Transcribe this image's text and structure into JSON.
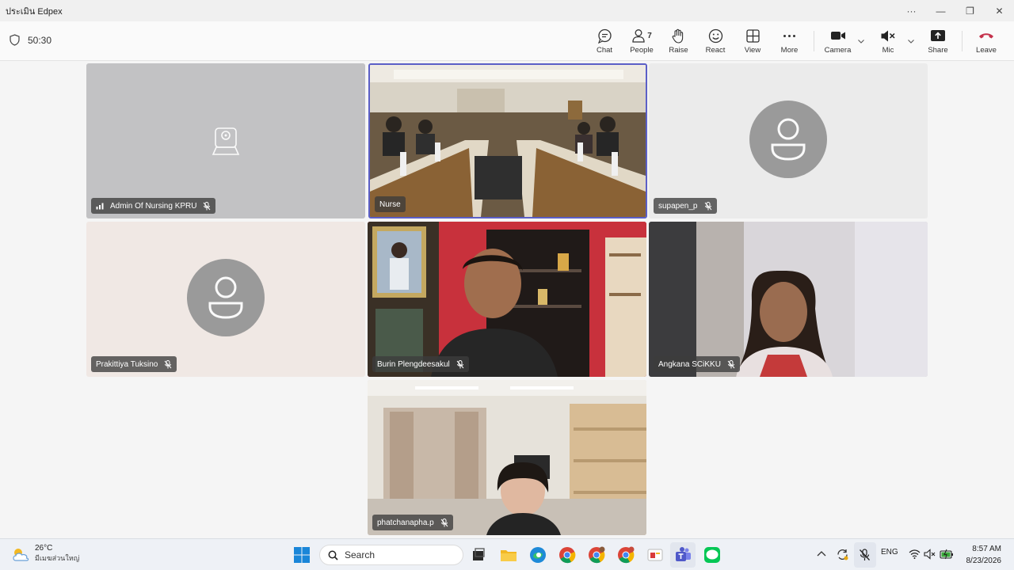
{
  "window": {
    "title": "ประเมิน Edpex"
  },
  "window_controls": {
    "more": "···",
    "minimize": "—",
    "maximize": "❐",
    "close": "✕"
  },
  "meeting": {
    "timer": "50:30"
  },
  "toolbar": {
    "chat": "Chat",
    "people": "People",
    "people_count": "7",
    "raise": "Raise",
    "react": "React",
    "view": "View",
    "more": "More",
    "camera": "Camera",
    "mic": "Mic",
    "share": "Share",
    "leave": "Leave"
  },
  "participants": [
    {
      "name": "Admin Of Nursing KPRU"
    },
    {
      "name": "Nurse"
    },
    {
      "name": "supapen_p"
    },
    {
      "name": "Prakittiya Tuksino"
    },
    {
      "name": "Burin Plengdeesakul"
    },
    {
      "name": "Angkana SCiKKU"
    },
    {
      "name": "phatchanapha.p"
    }
  ],
  "taskbar": {
    "weather_temp": "26°C",
    "weather_desc": "มีเมฆส่วนใหญ่",
    "search_label": "Search",
    "lang": "ENG",
    "time": "8:57 AM",
    "date": "8/23/2026"
  },
  "colors": {
    "accent": "#5b5fc7",
    "leave": "#c4314b"
  }
}
